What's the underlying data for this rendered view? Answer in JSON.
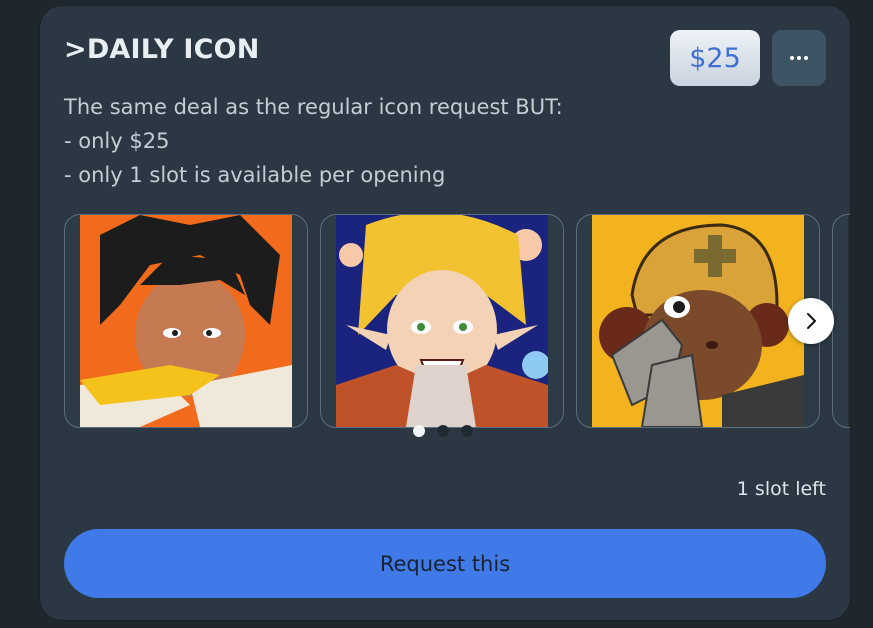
{
  "card": {
    "title": ">DAILY ICON",
    "price": "$25",
    "description": [
      "The same deal as the regular icon request BUT:",
      "- only $25",
      "- only 1 slot is available per opening"
    ],
    "slots_left": "1 slot left",
    "request_label": "Request this"
  },
  "carousel": {
    "images": [
      {
        "name": "dark-haired-character-art",
        "background": "#f26a1b"
      },
      {
        "name": "blonde-elf-character-art",
        "background": "#1a237e"
      },
      {
        "name": "helmet-character-art",
        "background": "#f2b31e"
      },
      {
        "name": "partial-character-art",
        "background": "#6a3fd8"
      }
    ],
    "dots": {
      "count": 3,
      "active": 0
    }
  },
  "colors": {
    "card_bg": "#2b3843",
    "accent": "#3f7ae8",
    "price_text": "#3f6fd0"
  },
  "icons": {
    "menu": "more-horizontal-icon",
    "next": "chevron-right-icon"
  }
}
